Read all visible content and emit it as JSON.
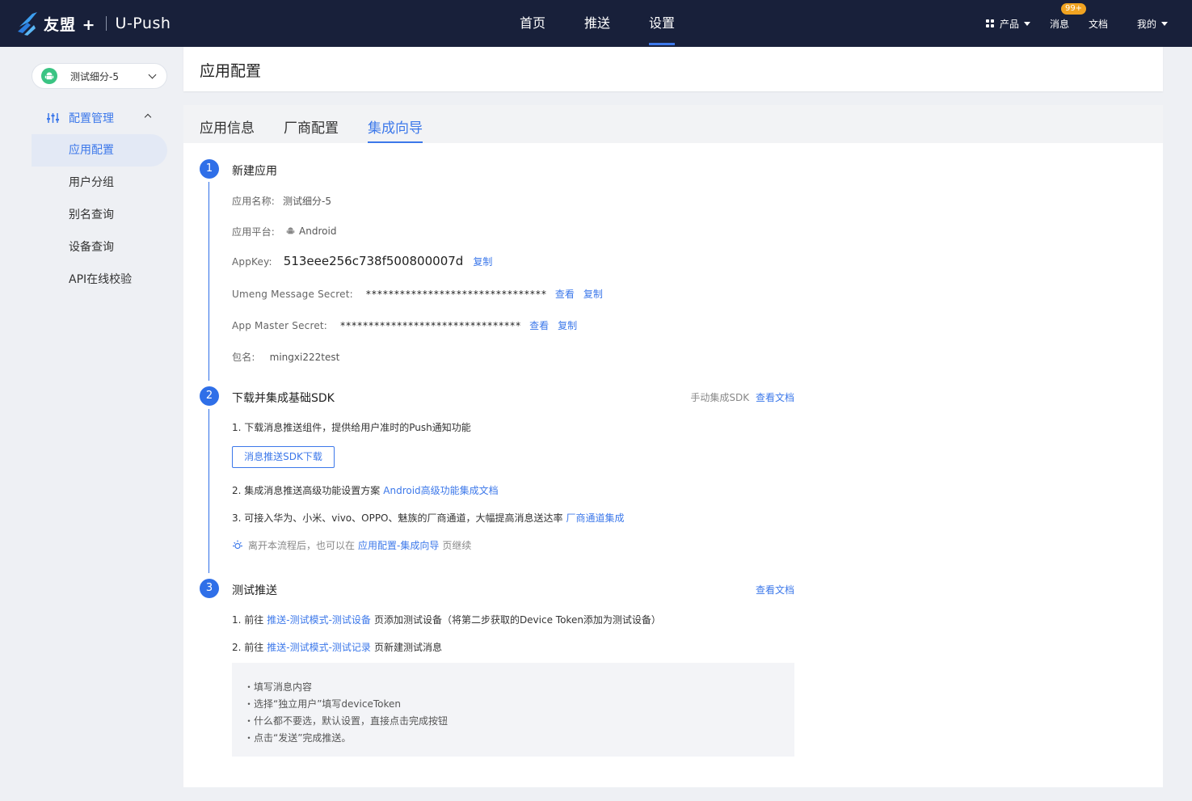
{
  "topnav": {
    "brand": "友盟 +",
    "product": "U-Push",
    "items": [
      "首页",
      "推送",
      "设置"
    ],
    "right": {
      "products": "产品",
      "messages": "消息",
      "messages_badge": "99+",
      "docs": "文档",
      "mine": "我的"
    }
  },
  "sidebar": {
    "app_name": "测试细分-5",
    "group_label": "配置管理",
    "items": [
      "应用配置",
      "用户分组",
      "别名查询",
      "设备查询",
      "API在线校验"
    ]
  },
  "page": {
    "title": "应用配置",
    "tabs": [
      "应用信息",
      "厂商配置",
      "集成向导"
    ]
  },
  "steps": {
    "step1": {
      "num": "1",
      "title": "新建应用",
      "app_name_label": "应用名称:",
      "app_name": "测试细分-5",
      "platform_label": "应用平台:",
      "platform": "Android",
      "appkey_label": "AppKey:",
      "appkey": "513eee256c738f500800007d",
      "copy": "复制",
      "msg_secret_label": "Umeng Message Secret:",
      "msg_secret": "********************************",
      "view": "查看",
      "master_secret_label": "App Master Secret:",
      "master_secret": "********************************",
      "package_label": "包名:",
      "package": "mingxi222test"
    },
    "step2": {
      "num": "2",
      "title": "下载并集成基础SDK",
      "manual_note": "手动集成SDK",
      "view_docs": "查看文档",
      "item1": "1. 下载消息推送组件，提供给用户准时的Push通知功能",
      "download_btn": "消息推送SDK下载",
      "item2_text": "2. 集成消息推送高级功能设置方案",
      "item2_link": "Android高级功能集成文档",
      "item3_text": "3. 可接入华为、小米、vivo、OPPO、魅族的厂商通道，大幅提高消息送达率",
      "item3_link": "厂商通道集成",
      "hint_prefix": "离开本流程后，也可以在",
      "hint_link": "应用配置-集成向导",
      "hint_suffix": "页继续"
    },
    "step3": {
      "num": "3",
      "title": "测试推送",
      "view_docs": "查看文档",
      "item1_prefix": "1. 前往",
      "item1_link": "推送-测试模式-测试设备",
      "item1_suffix": "页添加测试设备（将第二步获取的Device Token添加为测试设备）",
      "item2_prefix": "2. 前往",
      "item2_link": "推送-测试模式-测试记录",
      "item2_suffix": "页新建测试消息",
      "tips": [
        "・填写消息内容",
        "・选择“独立用户”填写deviceToken",
        "・什么都不要选，默认设置，直接点击完成按钮",
        "・点击“发送”完成推送。"
      ]
    }
  },
  "colors": {
    "topbar": "#18203a",
    "accent": "#3c78ea",
    "step": "#2f6fe8",
    "badge": "#f0a321",
    "android": "#3ac483"
  }
}
